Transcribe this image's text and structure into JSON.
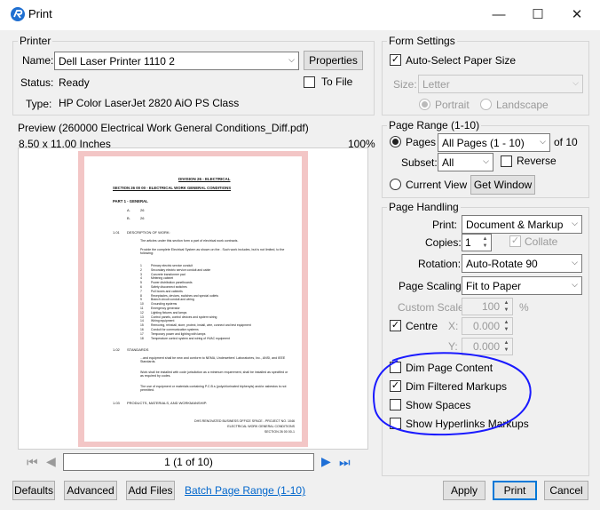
{
  "window": {
    "title": "Print"
  },
  "printer": {
    "group_label": "Printer",
    "name_label": "Name:",
    "name_value": "Dell Laser Printer 1110 2",
    "properties_label": "Properties",
    "status_label": "Status:",
    "status_value": "Ready",
    "to_file_label": "To File",
    "type_label": "Type:",
    "type_value": "HP Color LaserJet 2820 AiO PS Class"
  },
  "preview": {
    "label": "Preview (260000 Electrical Work General Conditions_Diff.pdf)",
    "size_text": "8.50  x  11.00 Inches",
    "zoom": "100%",
    "page_field": "1 (1 of 10)",
    "doc": {
      "division": "DIVISION 26 - ELECTRICAL",
      "section": "SECTION 26 00 00 - ELECTRICAL WORK GENERAL CONDITIONS",
      "part": "PART 1 - GENERAL",
      "itemA": "A.",
      "itemA_text": "26",
      "itemB": "B.",
      "itemB_text": "26",
      "s101": "1.01",
      "s101_title": "DESCRIPTION OF WORK:",
      "s101_a": "The articles under this section form a part of electrical work contracts.",
      "s101_b": "Provide the complete Electrical System as shown on the . Such work includes, but is not limited, to the following:",
      "list": [
        "Primary electric service conduit",
        "Secondary electric service conduit and cable",
        "Concrete transformer pad",
        "Metering cabinet",
        "Power distribution panelboards",
        "Safety disconnect switches",
        "Pull boxes and cabinets",
        "Receptacles, devices, switches and special outlets",
        "Branch circuit conduit and wiring",
        "Grounding systems",
        "Emergency generator",
        "Lighting fixtures and lamps",
        "Control panels, control devices and system wiring",
        "Wiring equipment",
        "Removing, reinstall, store, protect, install, wire, connect and test equipment",
        "Conduit for communication systems",
        "Temporary power and lighting with lamps",
        "Temperature control system and wiring of HVAC equipment"
      ],
      "s102": "1.02",
      "s102_title": "STANDARDS",
      "s102_a": "...and equipment shall be new and conform to NEMA, Underwriters' Laboratories, Inc., ANSI, and IEEE Standards.",
      "s102_b": "Work shall be installed with code jurisdiction as a minimum requirement, shall be installed as specified or as required by codes.",
      "s102_c": "The use of equipment or materials containing P.C.B.s (polychlorinated biphenyls) and/or asbestos is not permitted.",
      "s103": "1.03",
      "s103_title": "PRODUCTS, MATERIALS, AND WORKMANSHIP:",
      "footer1": "DHS RENOVATED BUSINESS OFFICE SPACE - PROJECT NO. 1046",
      "footer2": "ELECTRICAL WORK GENERAL CONDITIONS",
      "footer3": "SECTION 26 00 00-1"
    }
  },
  "form_settings": {
    "group_label": "Form Settings",
    "auto_select_label": "Auto-Select Paper Size",
    "size_label": "Size:",
    "size_value": "Letter",
    "portrait_label": "Portrait",
    "landscape_label": "Landscape"
  },
  "page_range": {
    "group_label": "Page Range (1-10)",
    "pages_label": "Pages",
    "pages_value": "All Pages (1 - 10)",
    "of_label": "of 10",
    "subset_label": "Subset:",
    "subset_value": "All",
    "reverse_label": "Reverse",
    "current_view_label": "Current View",
    "get_window_label": "Get Window"
  },
  "page_handling": {
    "group_label": "Page Handling",
    "print_label": "Print:",
    "print_value": "Document & Markup",
    "copies_label": "Copies:",
    "copies_value": "1",
    "collate_label": "Collate",
    "rotation_label": "Rotation:",
    "rotation_value": "Auto-Rotate 90",
    "scaling_label": "Page Scaling:",
    "scaling_value": "Fit to Paper",
    "custom_scale_label": "Custom Scale:",
    "custom_scale_value": "100",
    "percent": "%",
    "centre_label": "Centre",
    "x_label": "X:",
    "x_value": "0.000",
    "y_label": "Y:",
    "y_value": "0.000",
    "dim_page_label": "Dim Page Content",
    "dim_filtered_label": "Dim Filtered Markups",
    "show_spaces_label": "Show Spaces",
    "show_hyperlinks_label": "Show Hyperlinks Markups"
  },
  "footer": {
    "defaults": "Defaults",
    "advanced": "Advanced",
    "add_files": "Add Files",
    "batch_link": "Batch Page Range (1-10)",
    "apply": "Apply",
    "print": "Print",
    "cancel": "Cancel"
  },
  "colors": {
    "accent": "#0078d7",
    "annotation": "#1a1aff",
    "link": "#0066cc",
    "paper_border": "#f3c6c6"
  }
}
